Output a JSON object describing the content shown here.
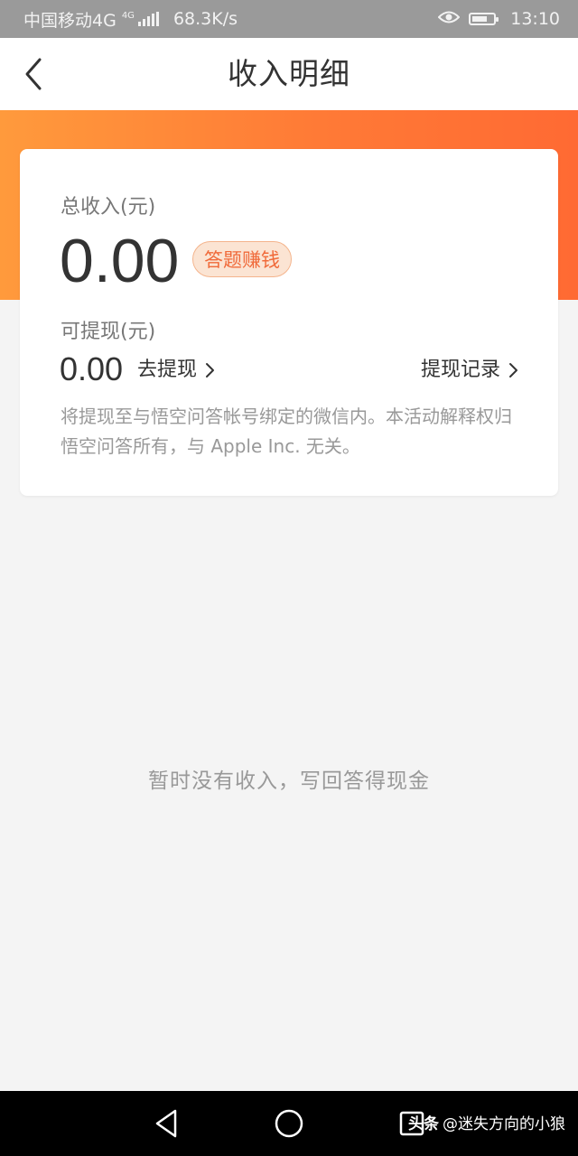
{
  "status_bar": {
    "carrier": "中国移动4G",
    "net_badge": "4G",
    "speed": "68.3K/s",
    "time": "13:10",
    "icons": [
      "signal-icon",
      "eye-icon",
      "battery-icon"
    ]
  },
  "header": {
    "title": "收入明细",
    "back_icon": "chevron-left-icon"
  },
  "colors": {
    "accent": "#ff7a36",
    "badge_text": "#f06a3a",
    "badge_bg": "#fbe4d3",
    "muted_text": "#999999"
  },
  "card": {
    "total_label": "总收入(元)",
    "total_amount": "0.00",
    "earn_badge": "答题赚钱",
    "withdrawable_label": "可提现(元)",
    "withdrawable_amount": "0.00",
    "withdraw_link": "去提现",
    "records_link": "提现记录",
    "note": "将提现至与悟空问答帐号绑定的微信内。本活动解释权归悟空问答所有，与 Apple Inc. 无关。"
  },
  "empty_state": {
    "text": "暂时没有收入，写回答得现金"
  },
  "nav_bar": {
    "icons": [
      "back-triangle-icon",
      "home-circle-icon",
      "recents-square-icon"
    ]
  },
  "watermark": {
    "brand": "头条",
    "handle": "@迷失方向的小狼"
  }
}
